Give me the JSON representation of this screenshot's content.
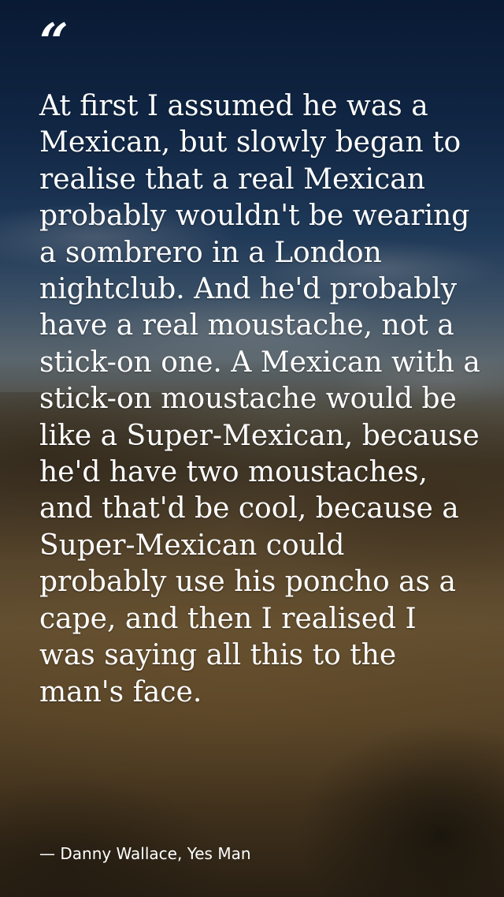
{
  "quote": {
    "mark": "“",
    "text": "At first I assumed he was a Mexican, but slowly began to realise that a real Mexican probably wouldn't be wearing a sombrero in a London nightclub. And he'd probably have a real moustache, not a stick-on one. A Mexican with a stick-on moustache would be like a Super-Mexican, because he'd have two moustaches, and that'd be cool, because a Super-Mexican could probably use his poncho as a cape, and then I realised I was saying all this to the man's face.",
    "attribution": "— Danny Wallace, Yes Man"
  },
  "colors": {
    "text": "#ffffff",
    "sky_top": "#0d2447",
    "ground": "#8a6e44"
  }
}
